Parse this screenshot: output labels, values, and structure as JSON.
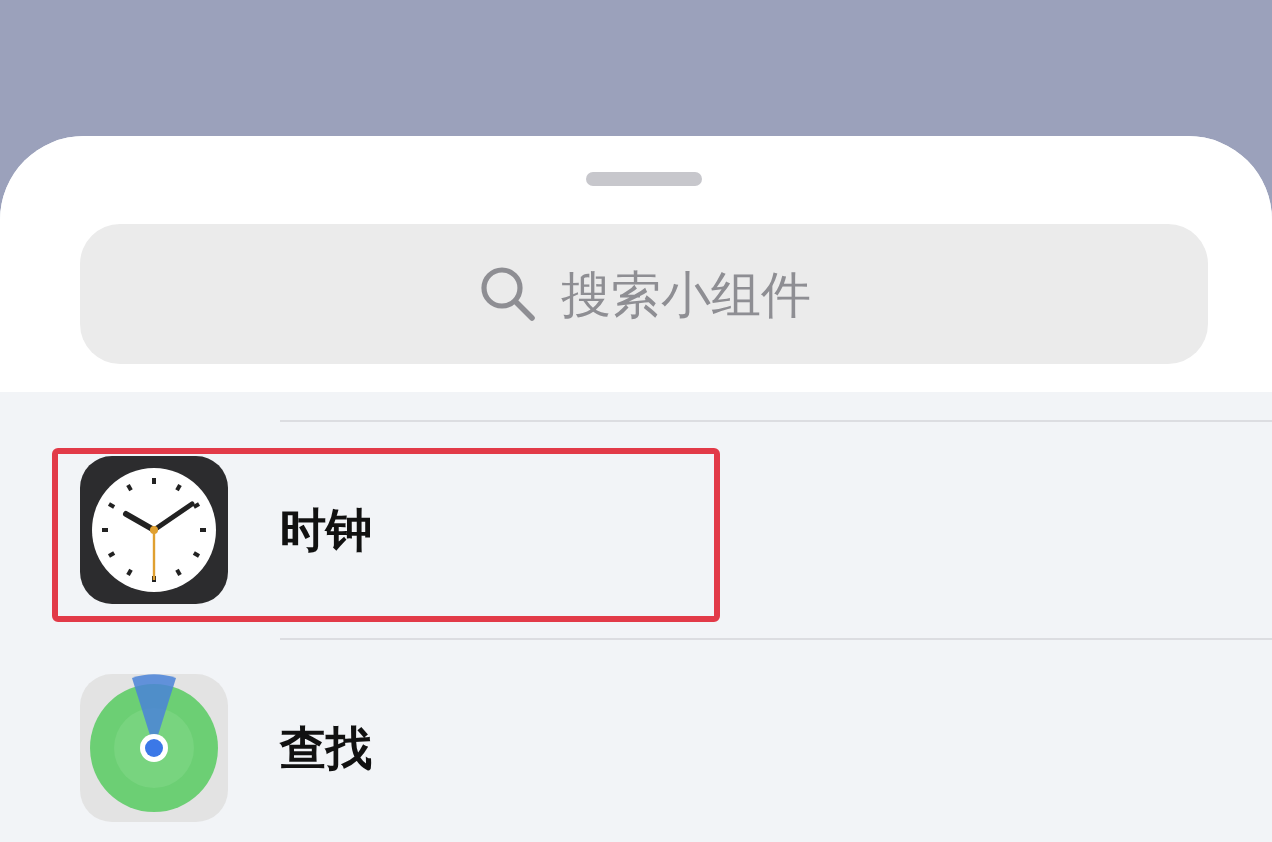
{
  "search": {
    "placeholder": "搜索小组件"
  },
  "items": [
    {
      "kind": "clock",
      "label": "时钟",
      "highlighted": true
    },
    {
      "kind": "find",
      "label": "查找",
      "highlighted": false
    }
  ]
}
